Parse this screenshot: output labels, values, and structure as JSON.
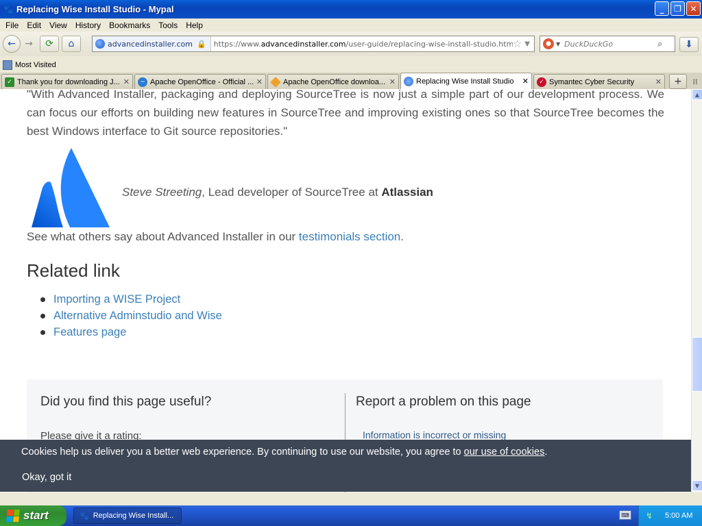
{
  "window": {
    "title": "Replacing Wise Install Studio - Mypal"
  },
  "menu": [
    "File",
    "Edit",
    "View",
    "History",
    "Bookmarks",
    "Tools",
    "Help"
  ],
  "address": {
    "site": "advancedinstaller.com",
    "url_prefix": "https://www.",
    "url_domain": "advancedinstaller.com",
    "url_path": "/user-guide/replacing-wise-install-studio.html"
  },
  "search": {
    "placeholder": "DuckDuckGo"
  },
  "bookmarks": {
    "most_visited": "Most Visited"
  },
  "tabs": [
    {
      "label": "Thank you for downloading J...",
      "color": "#2e8b2e",
      "icon": "download-page-icon"
    },
    {
      "label": "Apache OpenOffice - Official ...",
      "color": "#2b7bd1",
      "icon": "openoffice-icon"
    },
    {
      "label": "Apache OpenOffice downloa...",
      "color": "#f0a02a",
      "icon": "sourceforge-icon"
    },
    {
      "label": "Replacing Wise Install Studio",
      "color": "#2d6fd4",
      "icon": "advancedinstaller-icon",
      "active": true
    },
    {
      "label": "Symantec Cyber Security",
      "color": "#c8102e",
      "icon": "symantec-icon"
    }
  ],
  "page": {
    "quote": "\"With Advanced Installer, packaging and deploying SourceTree is now just a simple part of our development process. We can focus our efforts on building new features in SourceTree and improving existing ones so that SourceTree becomes the best Windows interface to Git source repositories.\"",
    "attribution_name": "Steve Streeting",
    "attribution_role": ", Lead developer of SourceTree at ",
    "attribution_company": "Atlassian",
    "see_what_prefix": "See what others say about Advanced Installer in our ",
    "see_what_link": "testimonials section",
    "see_what_suffix": ".",
    "related_heading": "Related link",
    "related_links": [
      "Importing a WISE Project",
      "Alternative Adminstudio and Wise",
      "Features page"
    ],
    "feedback_title": "Did you find this page useful?",
    "feedback_sub": "Please give it a rating:",
    "report_title": "Report a problem on this page",
    "report_link": "Information is incorrect or missing"
  },
  "cookie": {
    "text": "Cookies help us deliver you a better web experience. By continuing to use our website, you agree to ",
    "link": "our use of cookies",
    "suffix": ".",
    "ok": "Okay, got it"
  },
  "taskbar": {
    "start": "start",
    "item": "Replacing Wise Install...",
    "clock": "5:00 AM"
  },
  "colors": {
    "link": "#3a7fb8",
    "cookie_bg": "#3d4654",
    "atlassian_blue": "#2684ff"
  }
}
